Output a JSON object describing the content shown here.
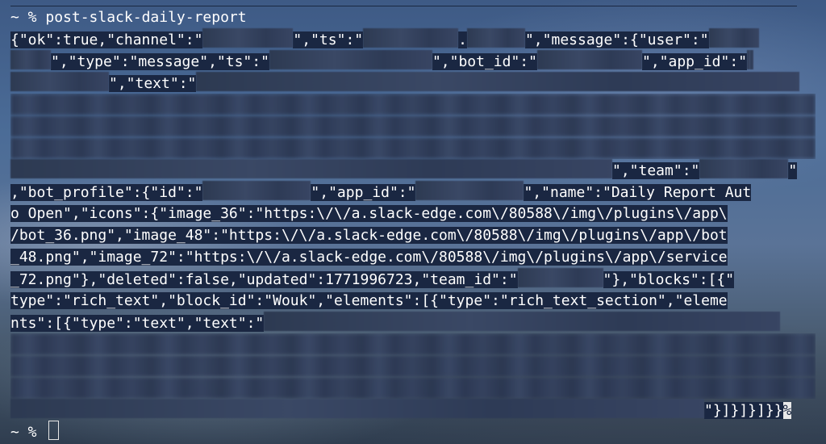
{
  "terminal": {
    "prompt": "~ % ",
    "command": "post-slack-daily-report",
    "lines": {
      "l1a": "{\"ok\":true,\"channel\":\"",
      "l1b": "\",\"ts\":\"",
      "l1c": ".",
      "l1d": "\",\"message\":{\"user\":\"",
      "l2a": "\",\"type\":\"message\",\"ts\":\"",
      "l2b": "\",\"bot_id\":\"",
      "l2c": "\",\"app_id\":\"",
      "l3a": "\",\"text\":\"",
      "l7a": "\",\"team\":\"",
      "l7b": "\"",
      "l8a": ",\"bot_profile\":{\"id\":\"",
      "l8b": "\",\"app_id\":\"",
      "l8c": "\",\"name\":\"Daily Report Aut",
      "l9": "o Open\",\"icons\":{\"image_36\":\"https:\\/\\/a.slack-edge.com\\/80588\\/img\\/plugins\\/app\\",
      "l10": "/bot_36.png\",\"image_48\":\"https:\\/\\/a.slack-edge.com\\/80588\\/img\\/plugins\\/app\\/bot",
      "l11": "_48.png\",\"image_72\":\"https:\\/\\/a.slack-edge.com\\/80588\\/img\\/plugins\\/app\\/service",
      "l12a": "_72.png\"},\"deleted\":false,\"updated\":1771996723,\"team_id\":\"",
      "l12b": "\"},\"blocks\":[{\"",
      "l13": "type\":\"rich_text\",\"block_id\":\"Wouk\",\"elements\":[{\"type\":\"rich_text_section\",\"eleme",
      "l14a": "nts\":[{\"type\":\"text\",\"text\":\"",
      "l18a": "\"}]}]}]}}",
      "l18b": "%"
    }
  }
}
